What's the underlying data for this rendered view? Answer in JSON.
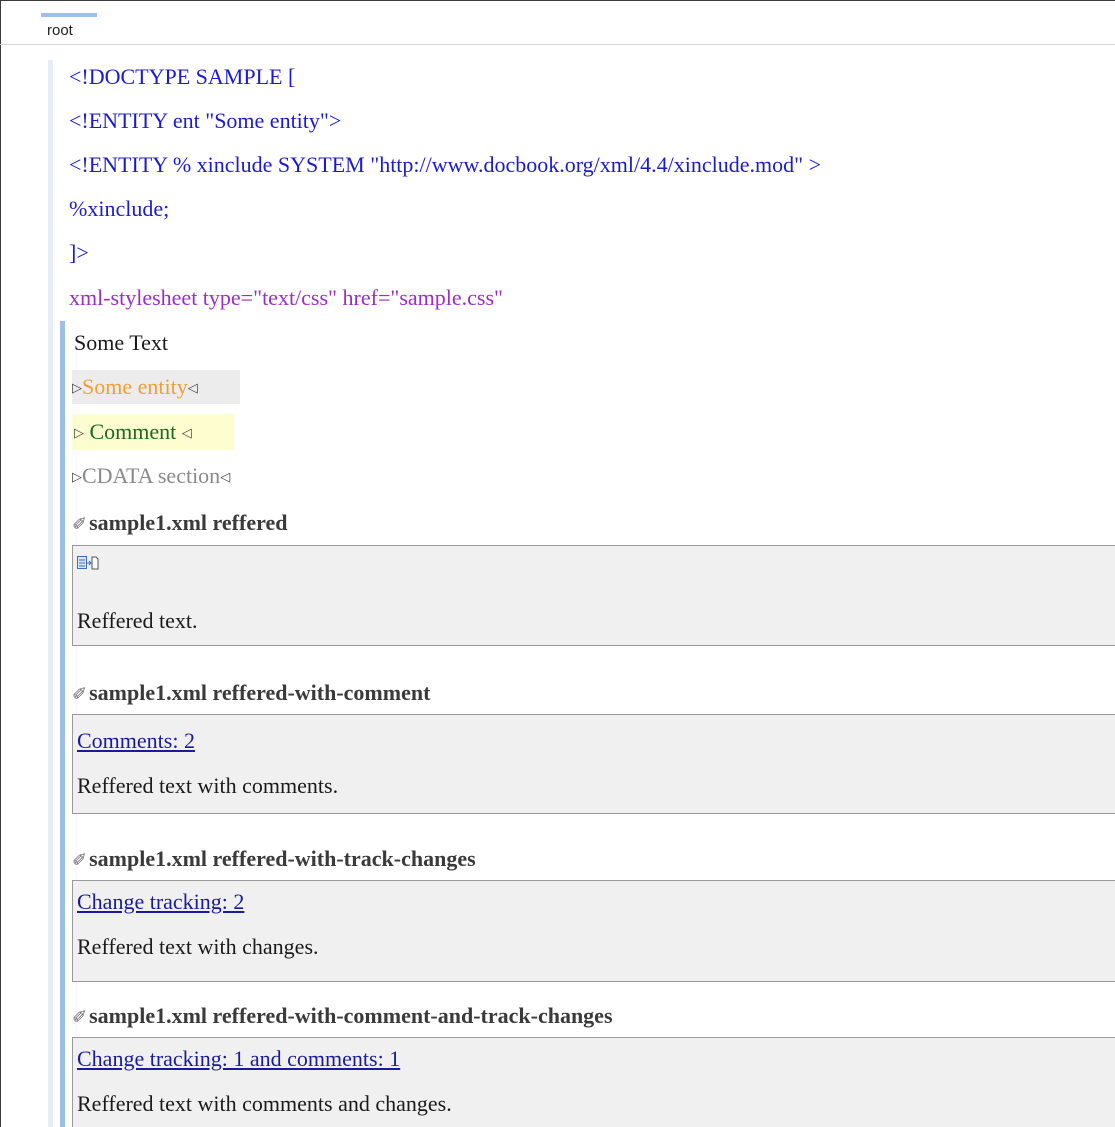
{
  "root_label": "root",
  "doctype_lines": [
    "<!DOCTYPE SAMPLE [",
    "<!ENTITY ent \"Some entity\">",
    "<!ENTITY % xinclude SYSTEM \"http://www.docbook.org/xml/4.4/xinclude.mod\" >",
    "%xinclude;",
    "]>"
  ],
  "processing_instruction": "xml-stylesheet type=\"text/css\" href=\"sample.css\"",
  "some_text": "Some Text",
  "entity": "Some entity",
  "comment": "Comment",
  "cdata": "CDATA section",
  "xincludes": [
    {
      "title": "sample1.xml reffered",
      "link": "",
      "text": "Reffered text."
    },
    {
      "title": "sample1.xml reffered-with-comment",
      "link": "Comments: 2",
      "text": "Reffered text with comments."
    },
    {
      "title": "sample1.xml reffered-with-track-changes",
      "link": "Change tracking: 2",
      "text": "Reffered text with  changes."
    },
    {
      "title": "sample1.xml reffered-with-comment-and-track-changes",
      "link": "Change tracking: 1 and comments: 1",
      "text": "Reffered text with comments and  changes."
    }
  ],
  "icons": {
    "marker_start": "right-triangle-icon",
    "marker_end": "left-triangle-icon",
    "xinclude": "paperclip-icon",
    "reference": "reference-icon"
  },
  "colors": {
    "doctype": "#1b1bcc",
    "pi": "#9b2ec6",
    "entity": "#f0a030",
    "comment": "#1c6a1c",
    "cdata": "#8a8a8a",
    "link": "#1b1b99",
    "gutter": "#9ec0e8"
  }
}
